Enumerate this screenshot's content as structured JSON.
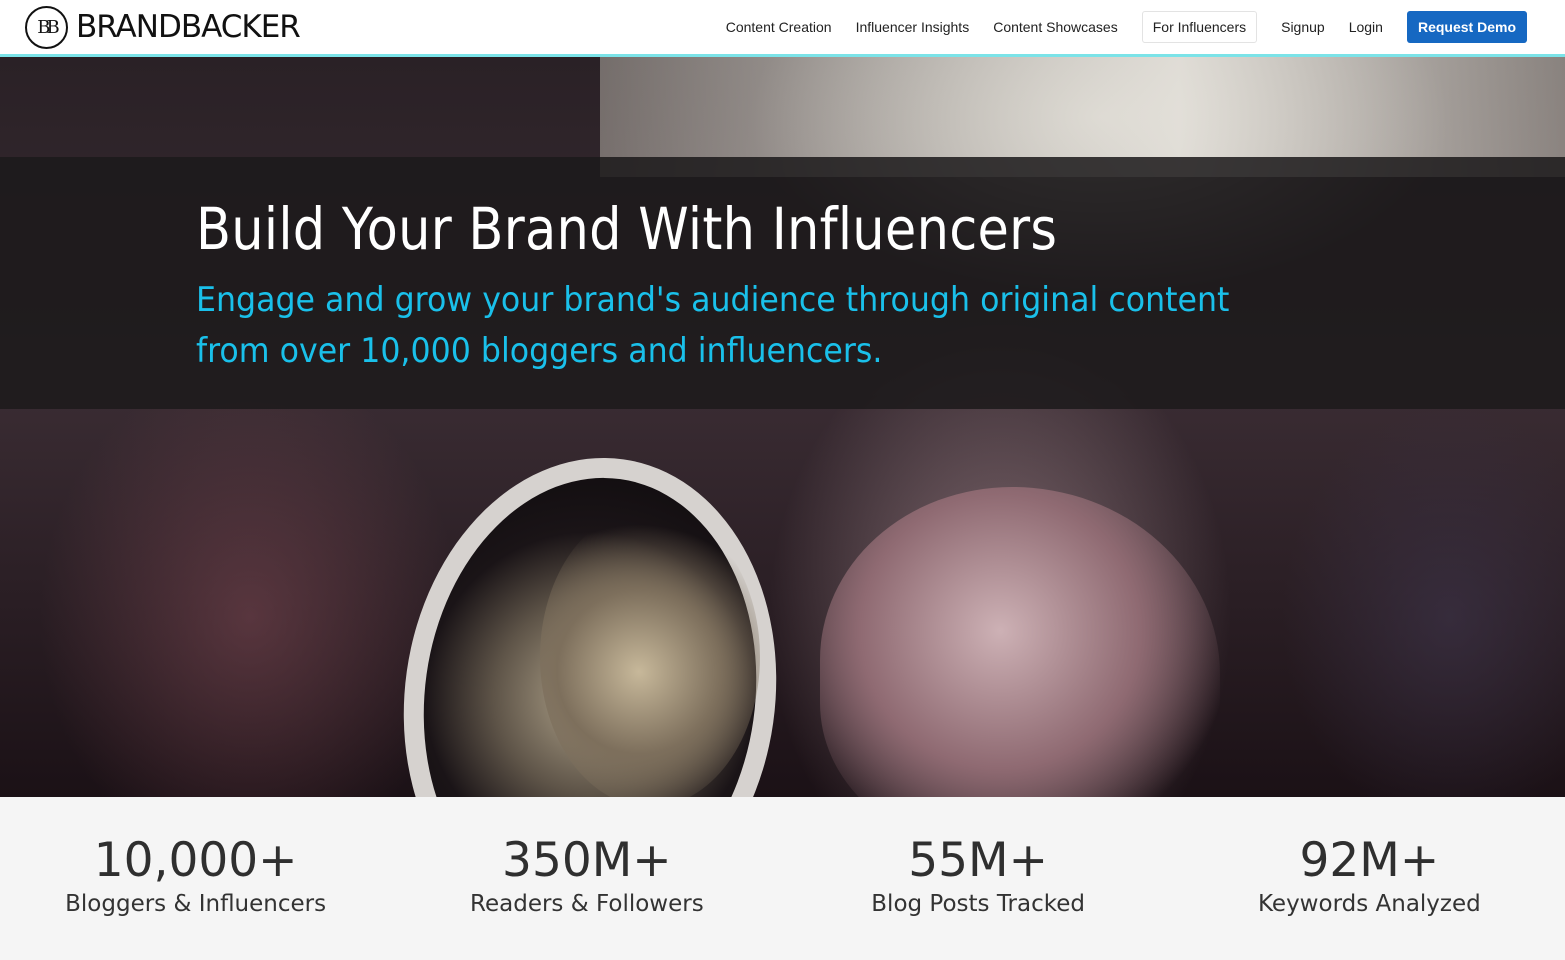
{
  "header": {
    "logo": {
      "mark": "BB",
      "text": "BRANDBACKER"
    },
    "nav": [
      {
        "label": "Content Creation"
      },
      {
        "label": "Influencer Insights"
      },
      {
        "label": "Content Showcases"
      },
      {
        "label": "For Influencers"
      },
      {
        "label": "Signup"
      },
      {
        "label": "Login"
      },
      {
        "label": "Request Demo"
      }
    ],
    "accent_color": "#7be3e8",
    "demo_color": "#1668c2"
  },
  "hero": {
    "title": "Build Your Brand With Influencers",
    "subtitle": "Engage and grow your brand's audience through original content from over 10,000 bloggers and influencers.",
    "subtitle_color": "#1ac0ea"
  },
  "stats": [
    {
      "value": "10,000+",
      "label": "Bloggers & Influencers"
    },
    {
      "value": "350M+",
      "label": "Readers & Followers"
    },
    {
      "value": "55M+",
      "label": "Blog Posts Tracked"
    },
    {
      "value": "92M+",
      "label": "Keywords Analyzed"
    }
  ]
}
